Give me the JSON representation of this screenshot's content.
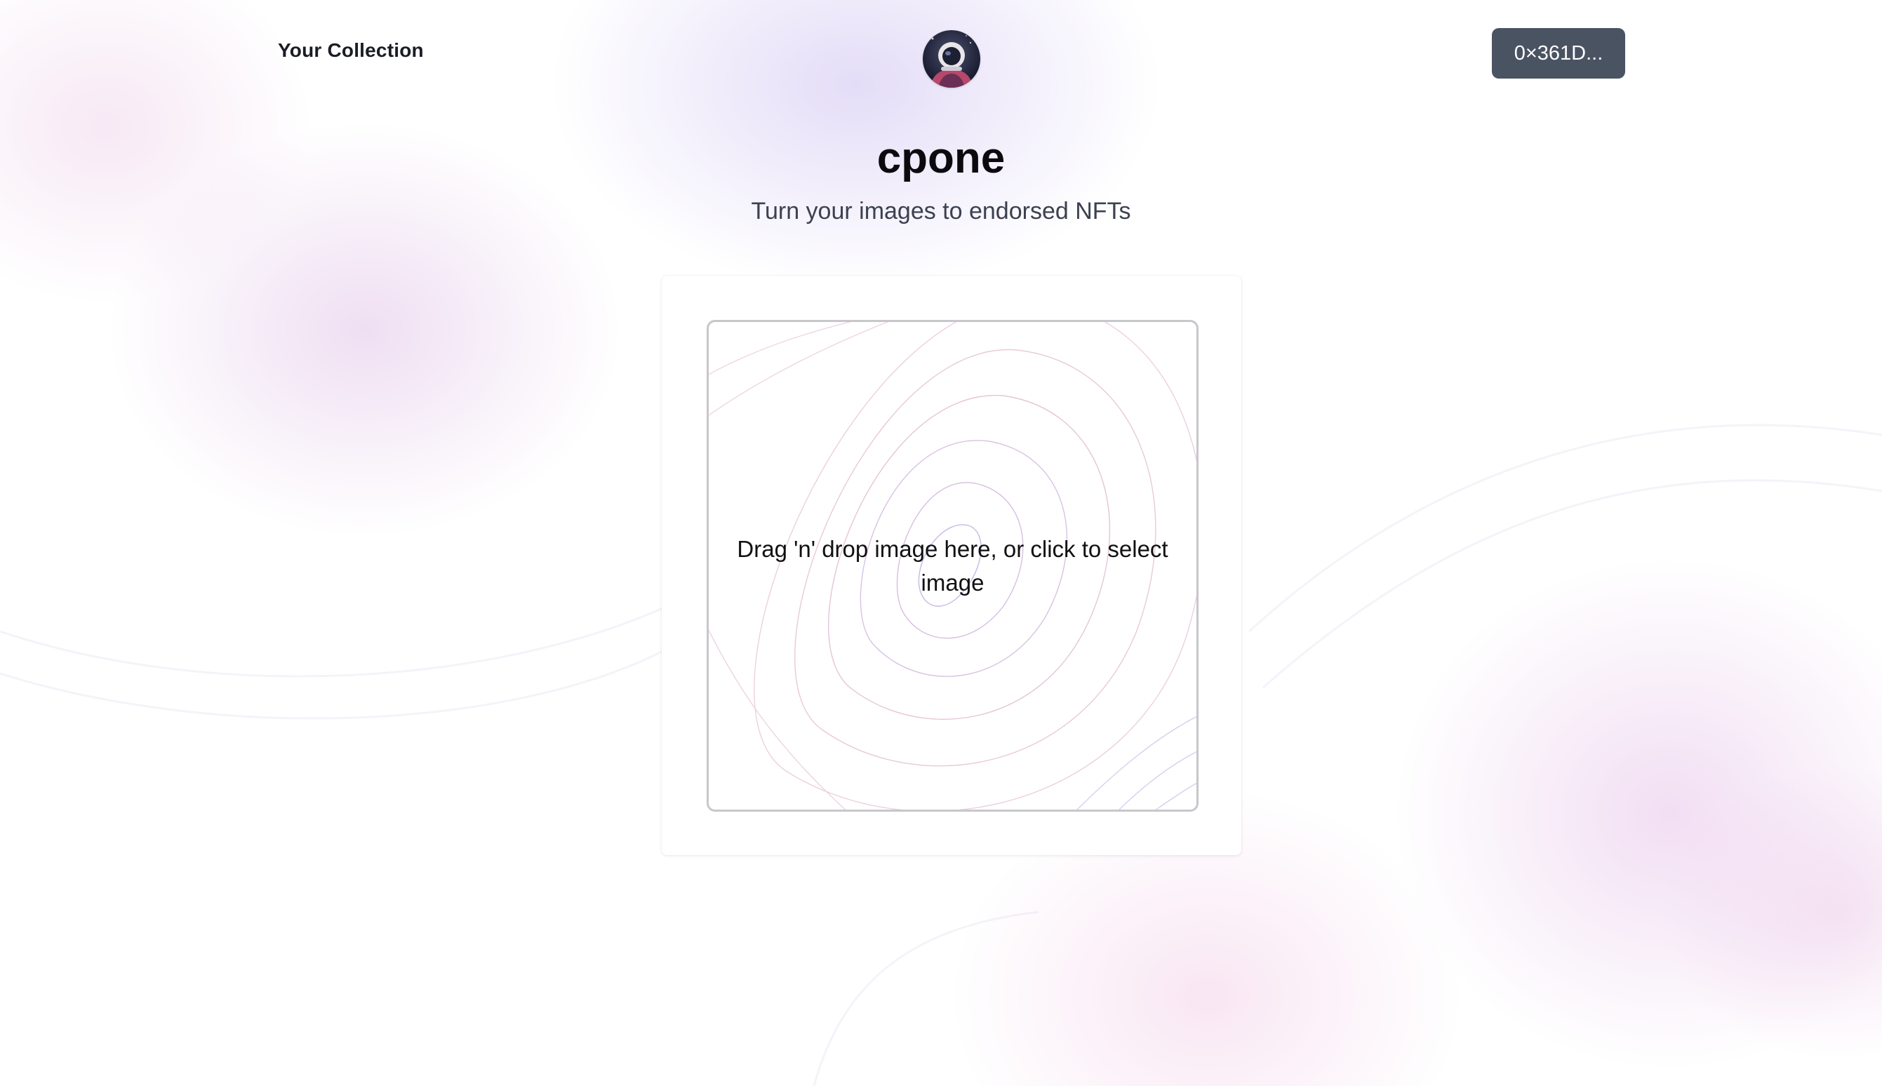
{
  "header": {
    "collection_link": "Your Collection",
    "avatar_icon": "astronaut-avatar-icon",
    "wallet_button": "0×361D..."
  },
  "main": {
    "title": "cpone",
    "subtitle": "Turn your images to endorsed NFTs",
    "dropzone_text": "Drag 'n' drop image here, or click to select image"
  },
  "colors": {
    "wallet_button_bg": "#4a5362",
    "title_text": "#0b0b0f",
    "subtitle_text": "#3c4150",
    "dropzone_border": "#c7c7cc"
  }
}
